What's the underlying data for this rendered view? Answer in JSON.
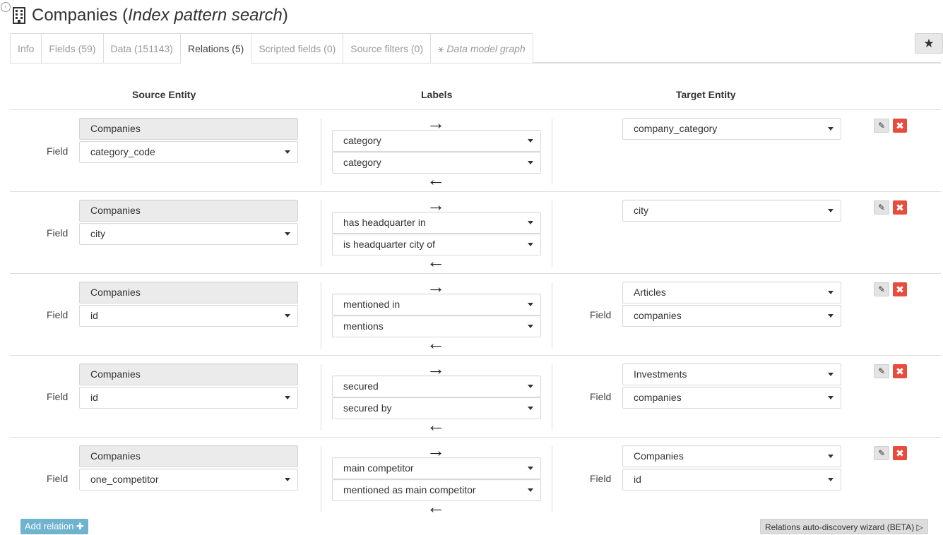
{
  "header": {
    "title_main": "Companies (",
    "title_italic": "Index pattern search",
    "title_end": ")"
  },
  "tabs": [
    {
      "label": "Info"
    },
    {
      "label": "Fields (59)"
    },
    {
      "label": "Data (151143)"
    },
    {
      "label": "Relations (5)"
    },
    {
      "label": "Scripted fields (0)"
    },
    {
      "label": "Source filters (0)"
    },
    {
      "label": "Data model graph"
    }
  ],
  "columns": {
    "source": "Source Entity",
    "labels": "Labels",
    "target": "Target Entity"
  },
  "field_label": "Field",
  "relations": [
    {
      "source_entity": "Companies",
      "source_field": "category_code",
      "forward_label": "category",
      "backward_label": "category",
      "target_entity": "company_category",
      "target_field": ""
    },
    {
      "source_entity": "Companies",
      "source_field": "city",
      "forward_label": "has headquarter in",
      "backward_label": "is headquarter city of",
      "target_entity": "city",
      "target_field": ""
    },
    {
      "source_entity": "Companies",
      "source_field": "id",
      "forward_label": "mentioned in",
      "backward_label": "mentions",
      "target_entity": "Articles",
      "target_field": "companies"
    },
    {
      "source_entity": "Companies",
      "source_field": "id",
      "forward_label": "secured",
      "backward_label": "secured by",
      "target_entity": "Investments",
      "target_field": "companies"
    },
    {
      "source_entity": "Companies",
      "source_field": "one_competitor",
      "forward_label": "main competitor",
      "backward_label": "mentioned as main competitor",
      "target_entity": "Companies",
      "target_field": "id"
    }
  ],
  "buttons": {
    "add_relation": "Add relation",
    "wizard": "Relations auto-discovery wizard (BETA)"
  },
  "glyphs": {
    "back": "‹",
    "star": "★",
    "graph": "⚹",
    "arrow_right": "→",
    "arrow_left": "←",
    "edit": "✎",
    "delete": "✖",
    "plus": "✚",
    "play": "▷"
  },
  "colors": {
    "delete": "#e74c3c",
    "add_button": "#6fb3cf"
  }
}
